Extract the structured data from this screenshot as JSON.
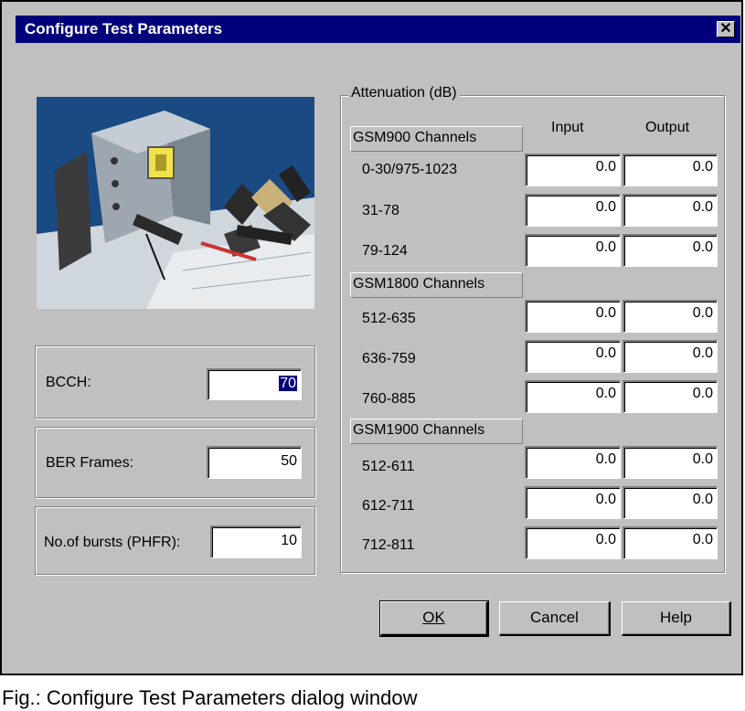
{
  "dialog": {
    "title": "Configure Test Parameters",
    "close_glyph": "✕"
  },
  "left": {
    "bcch_label": "BCCH:",
    "bcch_value": "70",
    "ber_label": "BER Frames:",
    "ber_value": "50",
    "bursts_label": "No.of bursts (PHFR):",
    "bursts_value": "10"
  },
  "attenuation": {
    "group_label": "Attenuation (dB)",
    "col_input": "Input",
    "col_output": "Output",
    "sections": [
      {
        "header": "GSM900 Channels",
        "rows": [
          {
            "label": "0-30/975-1023",
            "input": "0.0",
            "output": "0.0"
          },
          {
            "label": "31-78",
            "input": "0.0",
            "output": "0.0"
          },
          {
            "label": "79-124",
            "input": "0.0",
            "output": "0.0"
          }
        ]
      },
      {
        "header": "GSM1800 Channels",
        "rows": [
          {
            "label": "512-635",
            "input": "0.0",
            "output": "0.0"
          },
          {
            "label": "636-759",
            "input": "0.0",
            "output": "0.0"
          },
          {
            "label": "760-885",
            "input": "0.0",
            "output": "0.0"
          }
        ]
      },
      {
        "header": "GSM1900 Channels",
        "rows": [
          {
            "label": "512-611",
            "input": "0.0",
            "output": "0.0"
          },
          {
            "label": "612-711",
            "input": "0.0",
            "output": "0.0"
          },
          {
            "label": "712-811",
            "input": "0.0",
            "output": "0.0"
          }
        ]
      }
    ]
  },
  "buttons": {
    "ok": "OK",
    "cancel": "Cancel",
    "help": "Help"
  },
  "caption": "Fig.: Configure Test Parameters dialog window",
  "colors": {
    "titlebar": "#00007b",
    "dialog_bg": "#c0c0c0",
    "selection": "#00007b"
  }
}
